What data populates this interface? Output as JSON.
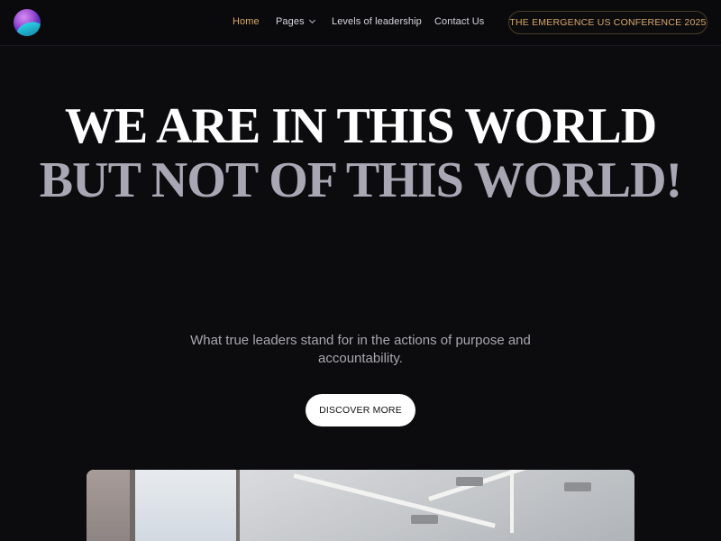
{
  "nav": {
    "items": [
      {
        "label": "Home",
        "active": true
      },
      {
        "label": "Pages",
        "has_dropdown": true
      },
      {
        "label": "Levels of leadership"
      },
      {
        "label": "Contact Us"
      }
    ],
    "cta_label": "THE EMERGENCE US CONFERENCE 2025"
  },
  "hero": {
    "title_line1": "WE ARE IN THIS WORLD",
    "title_line2": "BUT NOT OF THIS WORLD!",
    "subtitle": "What true leaders stand for in the actions of purpose and accountability.",
    "button_label": "DISCOVER MORE"
  },
  "colors": {
    "background": "#0c0c0e",
    "accent": "#d9a86a",
    "title_primary": "#ffffff",
    "title_secondary": "#a9a7b4"
  },
  "icons": {
    "logo": "gradient-sphere-logo",
    "dropdown": "chevron-down-icon"
  }
}
